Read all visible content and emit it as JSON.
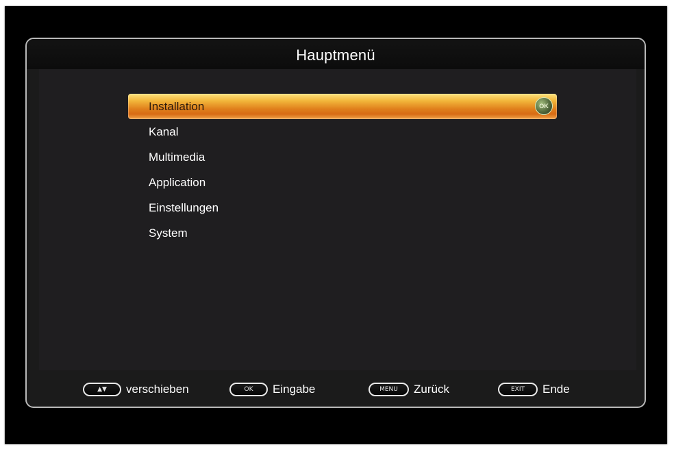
{
  "menu": {
    "title": "Hauptmenü",
    "items": [
      {
        "label": "Installation",
        "selected": true,
        "ok_label": "OK"
      },
      {
        "label": "Kanal",
        "selected": false
      },
      {
        "label": "Multimedia",
        "selected": false
      },
      {
        "label": "Application",
        "selected": false
      },
      {
        "label": "Einstellungen",
        "selected": false
      },
      {
        "label": "System",
        "selected": false
      }
    ]
  },
  "footer": {
    "move": {
      "key": "▲▼",
      "label": "verschieben"
    },
    "ok": {
      "key": "OK",
      "label": "Eingabe"
    },
    "menu": {
      "key": "MENU",
      "label": "Zurück"
    },
    "exit": {
      "key": "EXIT",
      "label": "Ende"
    }
  },
  "colors": {
    "highlight_top": "#fbe27d",
    "highlight_bottom": "#d86b14",
    "panel_background": "#1f1e20",
    "frame_border": "#b9b9b9"
  }
}
